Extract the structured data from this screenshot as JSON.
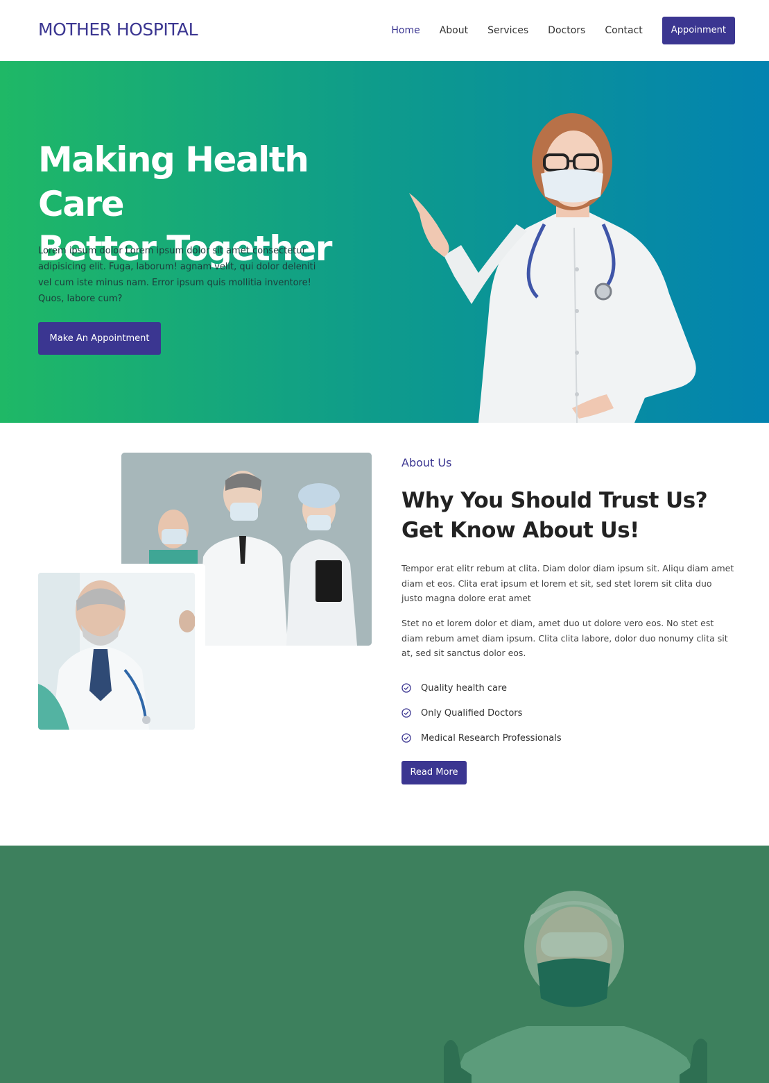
{
  "brand": {
    "name": "MOTHER HOSPITAL",
    "primary": "#3b3691",
    "green": "#1fb866",
    "blue": "#0383b0",
    "bottom_bg": "#3d805d"
  },
  "nav": {
    "items": [
      "Home",
      "About",
      "Services",
      "Doctors",
      "Contact"
    ],
    "active": "Home",
    "cta": "Appoinment"
  },
  "hero": {
    "title_line1": "Making Health Care",
    "title_line2": "Better Together",
    "text": "Lorem ipsum dolor Lorem ipsum dolor sit amet consectetur adipisicing elit. Fuga, laborum! agnam velit, qui dolor deleniti vel cum iste minus nam. Error ipsum quis mollitia inventore! Quos, labore cum?",
    "button": "Make An Appointment"
  },
  "about": {
    "eyebrow": "About Us",
    "title_line1": "Why You Should Trust Us?",
    "title_line2": "Get Know About Us!",
    "paragraph1": "Tempor erat elitr rebum at clita. Diam dolor diam ipsum sit. Aliqu diam amet diam et eos. Clita erat ipsum et lorem et sit, sed stet lorem sit clita duo justo magna dolore erat amet",
    "paragraph2": "Stet no et lorem dolor et diam, amet duo ut dolore vero eos. No stet est diam rebum amet diam ipsum. Clita clita labore, dolor duo nonumy clita sit at, sed sit sanctus dolor eos.",
    "checklist": [
      "Quality health care",
      "Only Qualified Doctors",
      "Medical Research Professionals"
    ],
    "check_icon": "check-circle-icon",
    "button": "Read More"
  }
}
